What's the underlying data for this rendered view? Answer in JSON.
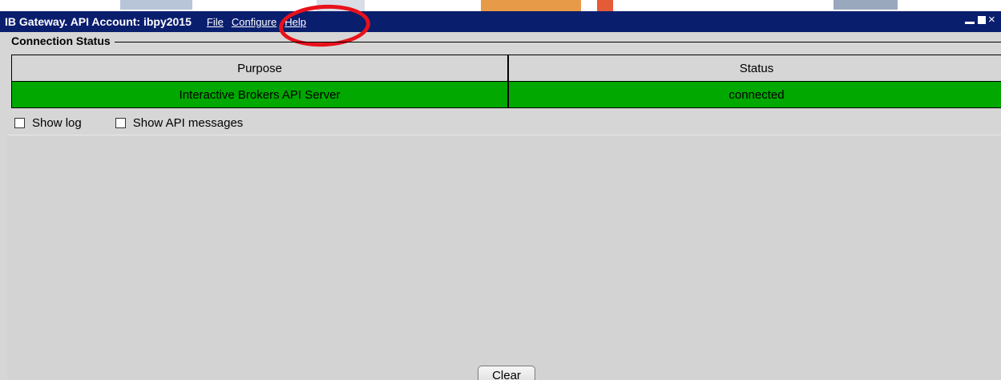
{
  "window": {
    "title": "IB Gateway.  API Account: ibpy2015"
  },
  "menu": {
    "items": [
      {
        "label": "File"
      },
      {
        "label": "Configure"
      },
      {
        "label": "Help"
      }
    ]
  },
  "connection_status": {
    "group_title": "Connection Status",
    "columns": [
      "Purpose",
      "Status"
    ],
    "rows": [
      {
        "purpose": "Interactive Brokers API Server",
        "status": "connected"
      }
    ]
  },
  "options": {
    "show_log": {
      "label": "Show log",
      "checked": false
    },
    "show_api_messages": {
      "label": "Show API messages",
      "checked": false
    }
  },
  "buttons": {
    "clear": "Clear"
  },
  "colors": {
    "titlebar": "#0a1e6e",
    "connected_row": "#00a800",
    "annotation": "#e8111b"
  }
}
